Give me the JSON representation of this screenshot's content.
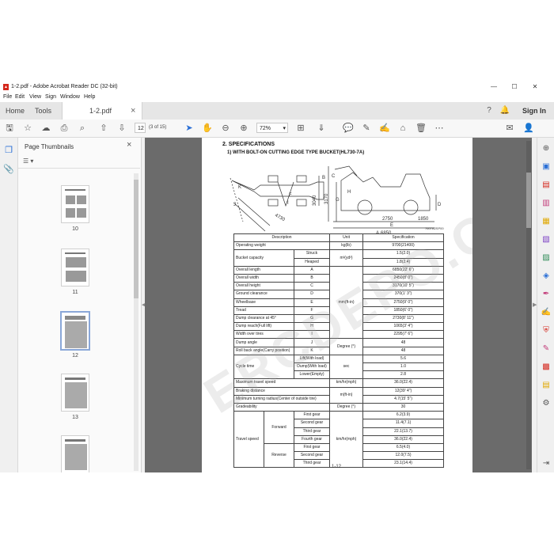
{
  "window": {
    "title": "1-2.pdf - Adobe Acrobat Reader DC (32-bit)",
    "controls": {
      "minimize": "—",
      "maximize": "☐",
      "close": "✕"
    }
  },
  "menu": [
    "File",
    "Edit",
    "View",
    "Sign",
    "Window",
    "Help"
  ],
  "tabs": {
    "home": "Home",
    "tools": "Tools",
    "doc": "1-2.pdf",
    "doc_close": "×",
    "sign_in": "Sign In"
  },
  "toolbar": {
    "page_current": "12",
    "page_total": "(3 of 15)",
    "zoom": "72%"
  },
  "thumbnails": {
    "title": "Page Thumbnails",
    "close": "×",
    "options": "▾",
    "pages": [
      {
        "label": "10"
      },
      {
        "label": "11"
      },
      {
        "label": "12",
        "selected": true
      },
      {
        "label": "13"
      },
      {
        "label": ""
      }
    ]
  },
  "document": {
    "section_title": "2. SPECIFICATIONS",
    "subsection_title": "1) WITH BOLT-ON CUTTING EDGE TYPE BUCKET(HL730-7A)",
    "figure_id": "7607A2SP00",
    "dims": {
      "d1": "4730",
      "d2": "3040",
      "d3": "3170",
      "d4": "1850",
      "d5": "2750",
      "d6": "6850",
      "let_a": "A",
      "let_e": "E",
      "let_b": "B",
      "let_c": "C",
      "let_h": "H",
      "let_g": "G",
      "let_i": "I",
      "let_k": "K",
      "let_j": "J",
      "let_f": "F",
      "let_d": "D"
    },
    "table": {
      "headers": {
        "description": "Description",
        "unit": "Unit",
        "specification": "Specification"
      },
      "operating_weight": {
        "label": "Operating weight",
        "unit": "kg(lb)",
        "value": "9700(21400)"
      },
      "bucket_capacity": {
        "label": "Bucket capacity",
        "unit": "m³(yd³)",
        "struck": {
          "label": "Struck",
          "value": "1.5(2.0)"
        },
        "heaped": {
          "label": "Heaped",
          "value": "1.8(2.4)"
        }
      },
      "dimensions_unit": "mm(ft-in)",
      "dimensions": [
        {
          "label": "Overall length",
          "code": "A",
          "value": "6850(22' 6\")"
        },
        {
          "label": "Overall width",
          "code": "B",
          "value": "2450(8' 0\")"
        },
        {
          "label": "Overall height",
          "code": "C",
          "value": "3170(10' 5\")"
        },
        {
          "label": "Ground clearance",
          "code": "D",
          "value": "370(1' 3\")"
        },
        {
          "label": "Wheelbase",
          "code": "E",
          "value": "2750(9' 0\")"
        },
        {
          "label": "Tread",
          "code": "F",
          "value": "1850(6' 0\")"
        },
        {
          "label": "Dump clearance at 45°",
          "code": "G",
          "value": "2730(8' 11\")"
        },
        {
          "label": "Dump reach(Full lift)",
          "code": "H",
          "value": "1065(3' 4\")"
        },
        {
          "label": "Width over tires",
          "code": "I",
          "value": "2295(7' 6\")"
        }
      ],
      "angles_unit": "Degree (°)",
      "angles": [
        {
          "label": "Dump angle",
          "code": "J",
          "value": "48"
        },
        {
          "label": "Roll back angle(Carry position)",
          "code": "K",
          "value": "48"
        }
      ],
      "cycle_time": {
        "label": "Cycle time",
        "unit": "sec",
        "rows": [
          {
            "label": "Lift(With load)",
            "value": "5.6"
          },
          {
            "label": "Dump(With load)",
            "value": "1.0"
          },
          {
            "label": "Lower(Empty)",
            "value": "2.8"
          }
        ]
      },
      "max_travel_speed": {
        "label": "Maximum travel speed",
        "unit": "km/hr(mph)",
        "value": "36.0(22.4)"
      },
      "braking_distance": {
        "label": "Braking distance",
        "unit": "m(ft-in)",
        "value": "12(39' 4\")"
      },
      "min_turning_radius": {
        "label": "Minimum turning radius(Center of outside tire)",
        "value": "4.7(15' 5\")"
      },
      "gradeability": {
        "label": "Gradeability",
        "unit": "Degree (°)",
        "value": "30"
      },
      "travel_speed": {
        "label": "Travel speed",
        "unit": "km/hr(mph)",
        "forward": {
          "label": "Forward",
          "gears": [
            {
              "label": "First gear",
              "value": "6.2(3.9)"
            },
            {
              "label": "Second gear",
              "value": "11.4(7.1)"
            },
            {
              "label": "Third gear",
              "value": "22.1(13.7)"
            },
            {
              "label": "Fourth gear",
              "value": "36.0(22.4)"
            }
          ]
        },
        "reverse": {
          "label": "Reverse",
          "gears": [
            {
              "label": "First gear",
              "value": "6.5(4.0)"
            },
            {
              "label": "Second gear",
              "value": "12.0(7.5)"
            },
            {
              "label": "Third gear",
              "value": "23.1(14.4)"
            }
          ]
        }
      }
    },
    "page_number": "1-12",
    "watermark": "ERCDEPO.COM"
  }
}
